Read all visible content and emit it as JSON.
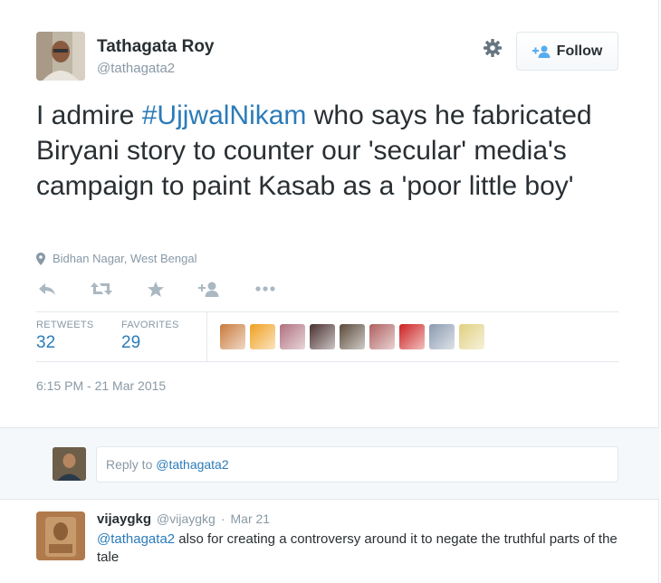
{
  "author": {
    "name": "Tathagata Roy",
    "handle": "@tathagata2"
  },
  "follow_label": "Follow",
  "tweet": {
    "text_part1": "I admire ",
    "hashtag": "#UjjwalNikam",
    "text_part2": " who says he fabricated Biryani story to counter our 'secular' media's campaign to paint Kasab as a 'poor little boy'"
  },
  "location": "Bidhan Nagar, West Bengal",
  "actions": [
    "reply-icon",
    "retweet-icon",
    "favorite-icon",
    "follow-user-icon",
    "more-icon"
  ],
  "stats": {
    "retweets_label": "RETWEETS",
    "retweets": "32",
    "favorites_label": "FAVORITES",
    "favorites": "29"
  },
  "favoriters_colors": [
    "#c97a3a",
    "#f0a020",
    "#b07080",
    "#4a3030",
    "#5a4a3a",
    "#b06060",
    "#cc2020",
    "#8a9ab0",
    "#e0d080"
  ],
  "timestamp": "6:15 PM - 21 Mar 2015",
  "reply_box": {
    "prefix": "Reply to ",
    "mention": "@tathagata2"
  },
  "reply": {
    "name": "vijaygkg",
    "handle": "@vijaygkg",
    "separator": "·",
    "date": "Mar 21",
    "mention": "@tathagata2",
    "text": " also for creating a controversy around it to negate the truthful parts of the tale"
  },
  "colors": {
    "link": "#2b7bb9",
    "muted": "#8899a6",
    "text": "#292f33",
    "border": "#e1e8ed"
  }
}
